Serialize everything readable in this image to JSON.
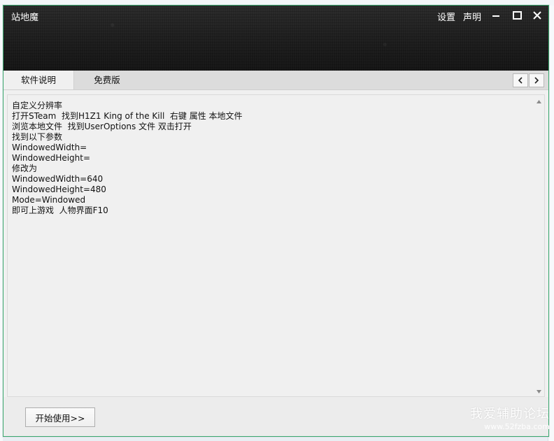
{
  "window": {
    "title": "站地魔",
    "settings_label": "设置",
    "statement_label": "声明"
  },
  "tabs": [
    {
      "label": "软件说明",
      "active": true
    },
    {
      "label": "免费版",
      "active": false
    }
  ],
  "content": {
    "lines": [
      "自定义分辨率",
      "打开STeam  找到H1Z1 King of the Kill  右键 属性 本地文件",
      "浏览本地文件  找到UserOptions 文件 双击打开",
      "找到以下参数",
      "WindowedWidth=",
      "WindowedHeight=",
      "修改为",
      "WindowedWidth=640",
      "WindowedHeight=480",
      "Mode=Windowed",
      "即可上游戏  人物界面F10"
    ]
  },
  "footer": {
    "start_label": "开始使用>>"
  },
  "watermark": {
    "main": "我爱辅助论坛",
    "sub": "www.52fzba.com"
  },
  "icons": {
    "minimize": "minimize-icon",
    "maximize": "maximize-icon",
    "close": "close-icon",
    "prev": "chevron-left-icon",
    "next": "chevron-right-icon"
  },
  "colors": {
    "header_bg": "#1e1e1e",
    "window_border": "#3aa86f",
    "panel_bg": "#f0f0f0",
    "tabbar_bg": "#dcdcdc"
  }
}
